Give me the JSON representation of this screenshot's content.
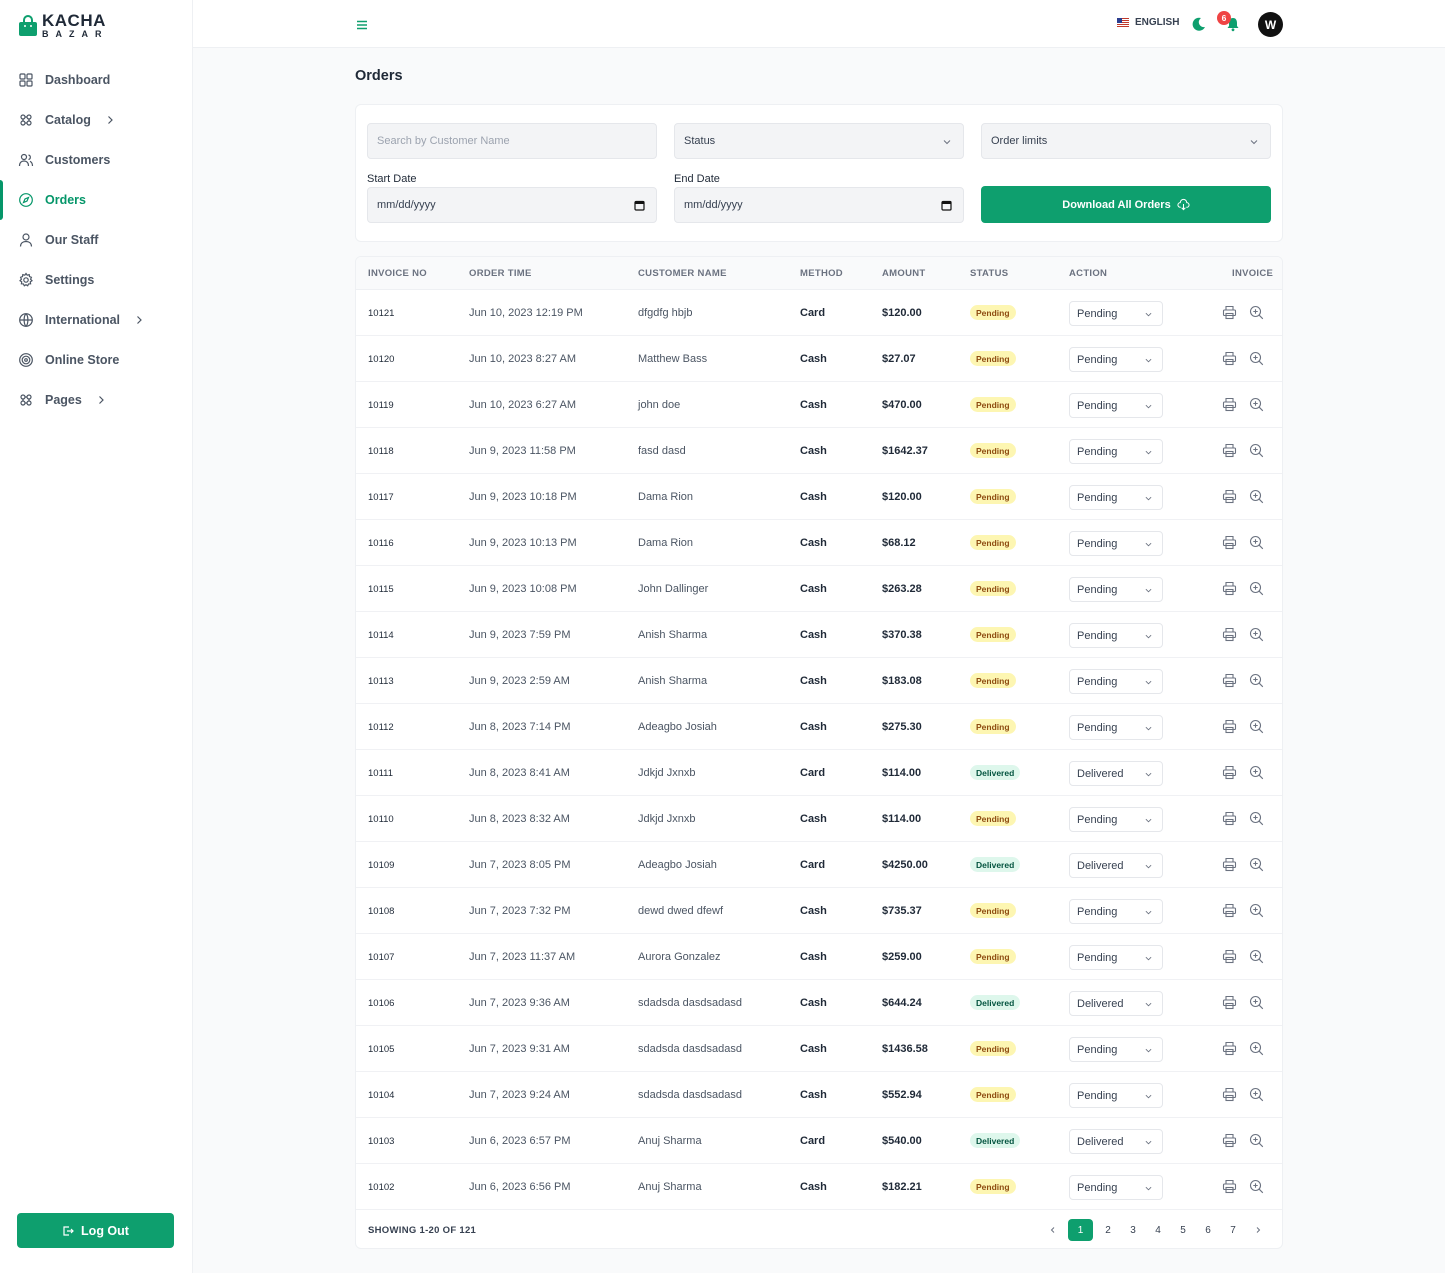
{
  "brand": {
    "name": "KACHA",
    "sub": "BAZAR"
  },
  "nav": [
    {
      "label": "Dashboard",
      "icon": "grid-icon",
      "chevron": false,
      "active": false
    },
    {
      "label": "Catalog",
      "icon": "catalog-icon",
      "chevron": true,
      "active": false
    },
    {
      "label": "Customers",
      "icon": "users-icon",
      "chevron": false,
      "active": false
    },
    {
      "label": "Orders",
      "icon": "compass-icon",
      "chevron": false,
      "active": true
    },
    {
      "label": "Our Staff",
      "icon": "user-icon",
      "chevron": false,
      "active": false
    },
    {
      "label": "Settings",
      "icon": "gear-icon",
      "chevron": false,
      "active": false
    },
    {
      "label": "International",
      "icon": "globe-icon",
      "chevron": true,
      "active": false
    },
    {
      "label": "Online Store",
      "icon": "target-icon",
      "chevron": false,
      "active": false
    },
    {
      "label": "Pages",
      "icon": "pages-icon",
      "chevron": true,
      "active": false
    }
  ],
  "logout_label": "Log Out",
  "header": {
    "language": "ENGLISH",
    "notification_count": "6",
    "avatar_initial": "W"
  },
  "page_title": "Orders",
  "filters": {
    "search_placeholder": "Search by Customer Name",
    "status_value": "Status",
    "limits_value": "Order limits",
    "start_label": "Start Date",
    "end_label": "End Date",
    "date_placeholder": "mm/dd/yyyy",
    "download_label": "Download All Orders"
  },
  "table": {
    "headers": {
      "invoice": "INVOICE NO",
      "time": "ORDER TIME",
      "customer": "CUSTOMER NAME",
      "method": "METHOD",
      "amount": "AMOUNT",
      "status": "STATUS",
      "action": "ACTION",
      "invoice_col": "INVOICE"
    },
    "rows": [
      {
        "invoice": "10121",
        "time": "Jun 10, 2023 12:19 PM",
        "customer": "dfgdfg hbjb",
        "method": "Card",
        "amount": "$120.00",
        "status": "Pending"
      },
      {
        "invoice": "10120",
        "time": "Jun 10, 2023 8:27 AM",
        "customer": "Matthew Bass",
        "method": "Cash",
        "amount": "$27.07",
        "status": "Pending"
      },
      {
        "invoice": "10119",
        "time": "Jun 10, 2023 6:27 AM",
        "customer": "john doe",
        "method": "Cash",
        "amount": "$470.00",
        "status": "Pending"
      },
      {
        "invoice": "10118",
        "time": "Jun 9, 2023 11:58 PM",
        "customer": "fasd dasd",
        "method": "Cash",
        "amount": "$1642.37",
        "status": "Pending"
      },
      {
        "invoice": "10117",
        "time": "Jun 9, 2023 10:18 PM",
        "customer": "Dama Rion",
        "method": "Cash",
        "amount": "$120.00",
        "status": "Pending"
      },
      {
        "invoice": "10116",
        "time": "Jun 9, 2023 10:13 PM",
        "customer": "Dama Rion",
        "method": "Cash",
        "amount": "$68.12",
        "status": "Pending"
      },
      {
        "invoice": "10115",
        "time": "Jun 9, 2023 10:08 PM",
        "customer": "John Dallinger",
        "method": "Cash",
        "amount": "$263.28",
        "status": "Pending"
      },
      {
        "invoice": "10114",
        "time": "Jun 9, 2023 7:59 PM",
        "customer": "Anish Sharma",
        "method": "Cash",
        "amount": "$370.38",
        "status": "Pending"
      },
      {
        "invoice": "10113",
        "time": "Jun 9, 2023 2:59 AM",
        "customer": "Anish Sharma",
        "method": "Cash",
        "amount": "$183.08",
        "status": "Pending"
      },
      {
        "invoice": "10112",
        "time": "Jun 8, 2023 7:14 PM",
        "customer": "Adeagbo Josiah",
        "method": "Cash",
        "amount": "$275.30",
        "status": "Pending"
      },
      {
        "invoice": "10111",
        "time": "Jun 8, 2023 8:41 AM",
        "customer": "Jdkjd Jxnxb",
        "method": "Card",
        "amount": "$114.00",
        "status": "Delivered"
      },
      {
        "invoice": "10110",
        "time": "Jun 8, 2023 8:32 AM",
        "customer": "Jdkjd Jxnxb",
        "method": "Cash",
        "amount": "$114.00",
        "status": "Pending"
      },
      {
        "invoice": "10109",
        "time": "Jun 7, 2023 8:05 PM",
        "customer": "Adeagbo Josiah",
        "method": "Card",
        "amount": "$4250.00",
        "status": "Delivered"
      },
      {
        "invoice": "10108",
        "time": "Jun 7, 2023 7:32 PM",
        "customer": "dewd dwed dfewf",
        "method": "Cash",
        "amount": "$735.37",
        "status": "Pending"
      },
      {
        "invoice": "10107",
        "time": "Jun 7, 2023 11:37 AM",
        "customer": "Aurora Gonzalez",
        "method": "Cash",
        "amount": "$259.00",
        "status": "Pending"
      },
      {
        "invoice": "10106",
        "time": "Jun 7, 2023 9:36 AM",
        "customer": "sdadsda dasdsadasd",
        "method": "Cash",
        "amount": "$644.24",
        "status": "Delivered"
      },
      {
        "invoice": "10105",
        "time": "Jun 7, 2023 9:31 AM",
        "customer": "sdadsda dasdsadasd",
        "method": "Cash",
        "amount": "$1436.58",
        "status": "Pending"
      },
      {
        "invoice": "10104",
        "time": "Jun 7, 2023 9:24 AM",
        "customer": "sdadsda dasdsadasd",
        "method": "Cash",
        "amount": "$552.94",
        "status": "Pending"
      },
      {
        "invoice": "10103",
        "time": "Jun 6, 2023 6:57 PM",
        "customer": "Anuj Sharma",
        "method": "Card",
        "amount": "$540.00",
        "status": "Delivered"
      },
      {
        "invoice": "10102",
        "time": "Jun 6, 2023 6:56 PM",
        "customer": "Anuj Sharma",
        "method": "Cash",
        "amount": "$182.21",
        "status": "Pending"
      }
    ],
    "showing": "SHOWING 1-20 OF 121",
    "pages": [
      "1",
      "2",
      "3",
      "4",
      "5",
      "6",
      "7"
    ],
    "current_page": "1"
  },
  "colors": {
    "accent": "#0e9f6e",
    "pending_bg": "#fdf6b2",
    "delivered_bg": "#def7ec"
  }
}
